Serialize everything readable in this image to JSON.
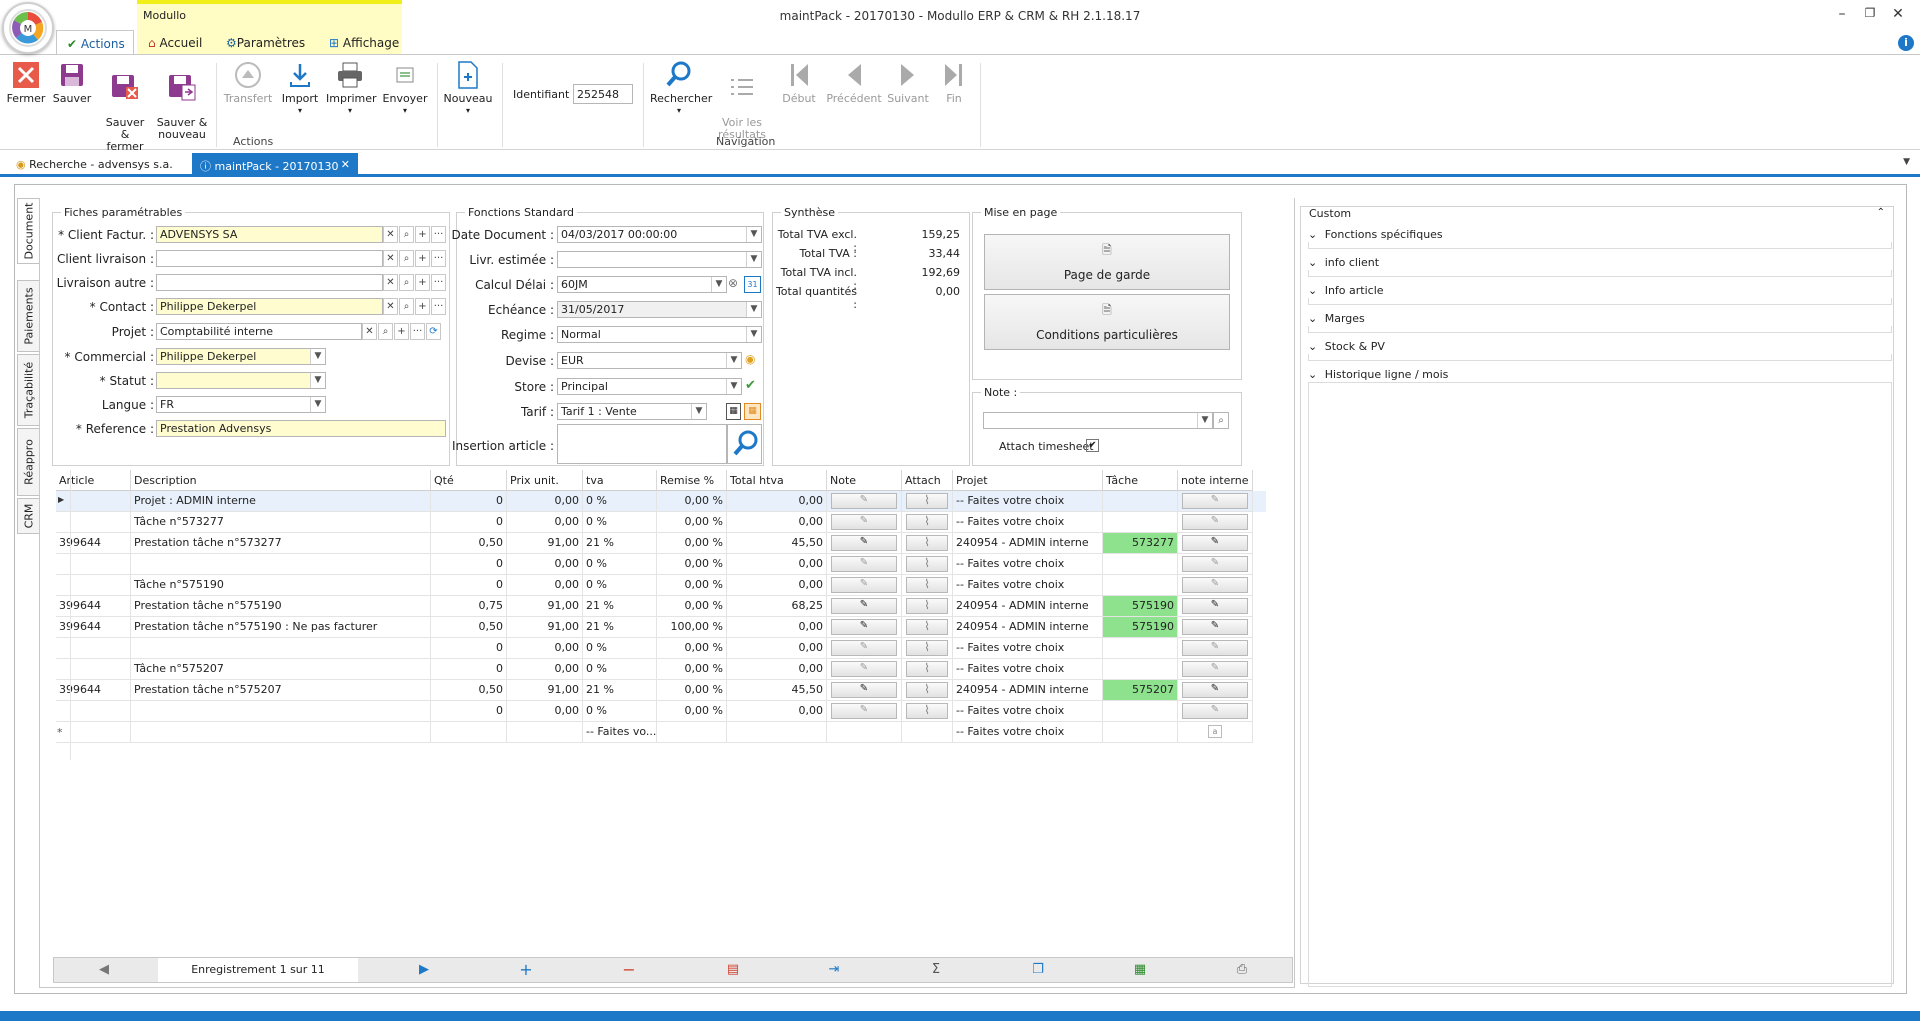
{
  "window": {
    "title": "maintPack - 20170130 - Modullo ERP & CRM & RH 2.1.18.17",
    "context_label": "Modullo"
  },
  "ribbon_tabs": [
    {
      "label": "Actions",
      "active": true
    },
    {
      "label": "Accueil"
    },
    {
      "label": "Paramètres"
    },
    {
      "label": "Affichage"
    }
  ],
  "ribbon": {
    "actions": [
      "Fermer",
      "Sauver",
      "Sauver &\nfermer",
      "Sauver &\nnouveau",
      "Transfert",
      "Import",
      "Imprimer",
      "Envoyer",
      "Nouveau"
    ],
    "actions_group": "Actions",
    "identifiant_label": "Identifiant :",
    "identifiant_value": "252548",
    "nav": [
      "Rechercher",
      "Voir les\nrésultats",
      "Début",
      "Précédent",
      "Suivant",
      "Fin"
    ],
    "nav_group": "Navigation"
  },
  "doc_tabs": [
    {
      "label": "Recherche - advensys s.a."
    },
    {
      "label": "maintPack - 20170130",
      "active": true
    }
  ],
  "vtabs": [
    "Document",
    "Paiements",
    "Traçabilité",
    "Réappro",
    "CRM"
  ],
  "fiches": {
    "title": "Fiches paramétrables",
    "rows": [
      {
        "label": "* Client Factur. :",
        "value": "ADVENSYS SA"
      },
      {
        "label": "Client livraison :",
        "value": ""
      },
      {
        "label": "Livraison autre :",
        "value": ""
      },
      {
        "label": "* Contact :",
        "value": "Philippe Dekerpel"
      },
      {
        "label": "Projet :",
        "value": "Comptabilité interne"
      },
      {
        "label": "* Commercial :",
        "value": "Philippe Dekerpel"
      },
      {
        "label": "* Statut :",
        "value": ""
      },
      {
        "label": "Langue :",
        "value": "FR"
      },
      {
        "label": "* Reference :",
        "value": "Prestation Advensys"
      }
    ]
  },
  "standard": {
    "title": "Fonctions Standard",
    "rows": [
      {
        "label": "Date Document :",
        "value": "04/03/2017 00:00:00"
      },
      {
        "label": "Livr. estimée :",
        "value": ""
      },
      {
        "label": "Calcul Délai :",
        "value": "60JM"
      },
      {
        "label": "Echéance :",
        "value": "31/05/2017"
      },
      {
        "label": "Regime :",
        "value": "Normal"
      },
      {
        "label": "Devise :",
        "value": "EUR"
      },
      {
        "label": "Store :",
        "value": "Principal"
      },
      {
        "label": "Tarif :",
        "value": "Tarif 1 : Vente"
      }
    ],
    "insertion_label": "Insertion article :"
  },
  "synthese": {
    "title": "Synthèse",
    "rows": [
      {
        "label": "Total TVA excl. :",
        "value": "159,25"
      },
      {
        "label": "Total TVA :",
        "value": "33,44"
      },
      {
        "label": "Total TVA incl. :",
        "value": "192,69"
      },
      {
        "label": "Total quantités :",
        "value": "0,00"
      }
    ]
  },
  "mise_en_page": {
    "title": "Mise en page",
    "btn1": "Page de garde",
    "btn2": "Conditions particulières"
  },
  "note": {
    "title": "Note :",
    "timesheet": "Attach timesheet"
  },
  "grid": {
    "headers": [
      "Article",
      "Description",
      "Qté",
      "Prix unit.",
      "tva",
      "Remise %",
      "Total htva",
      "Note",
      "Attach",
      "Projet",
      "Tâche",
      "note interne"
    ],
    "rows": [
      [
        "",
        "Projet : ADMIN interne",
        "0",
        "0,00",
        "0 %",
        "0,00 %",
        "0,00",
        "-- Faites votre choix",
        ""
      ],
      [
        "",
        "Tâche n°573277",
        "0",
        "0,00",
        "0 %",
        "0,00 %",
        "0,00",
        "-- Faites votre choix",
        ""
      ],
      [
        "399644",
        "Prestation tâche n°573277",
        "0,50",
        "91,00",
        "21 %",
        "0,00 %",
        "45,50",
        "240954 - ADMIN interne",
        "573277"
      ],
      [
        "",
        "",
        "0",
        "0,00",
        "0 %",
        "0,00 %",
        "0,00",
        "-- Faites votre choix",
        ""
      ],
      [
        "",
        "Tâche n°575190",
        "0",
        "0,00",
        "0 %",
        "0,00 %",
        "0,00",
        "-- Faites votre choix",
        ""
      ],
      [
        "399644",
        "Prestation tâche n°575190",
        "0,75",
        "91,00",
        "21 %",
        "0,00 %",
        "68,25",
        "240954 - ADMIN interne",
        "575190"
      ],
      [
        "399644",
        "Prestation tâche n°575190 : Ne pas facturer",
        "0,50",
        "91,00",
        "21 %",
        "100,00 %",
        "0,00",
        "240954 - ADMIN interne",
        "575190"
      ],
      [
        "",
        "",
        "0",
        "0,00",
        "0 %",
        "0,00 %",
        "0,00",
        "-- Faites votre choix",
        ""
      ],
      [
        "",
        "Tâche n°575207",
        "0",
        "0,00",
        "0 %",
        "0,00 %",
        "0,00",
        "-- Faites votre choix",
        ""
      ],
      [
        "399644",
        "Prestation tâche n°575207",
        "0,50",
        "91,00",
        "21 %",
        "0,00 %",
        "45,50",
        "240954 - ADMIN interne",
        "575207"
      ],
      [
        "",
        "",
        "0",
        "0,00",
        "0 %",
        "0,00 %",
        "0,00",
        "-- Faites votre choix",
        ""
      ]
    ],
    "new_row": {
      "tva": "-- Faites vo...",
      "projet": "-- Faites votre choix"
    }
  },
  "navbar": {
    "record": "Enregistrement 1 sur 11"
  },
  "custom": {
    "title": "Custom",
    "items": [
      "Fonctions spécifiques",
      "info client",
      "Info article",
      "Marges",
      "Stock & PV",
      "Historique ligne / mois"
    ]
  }
}
